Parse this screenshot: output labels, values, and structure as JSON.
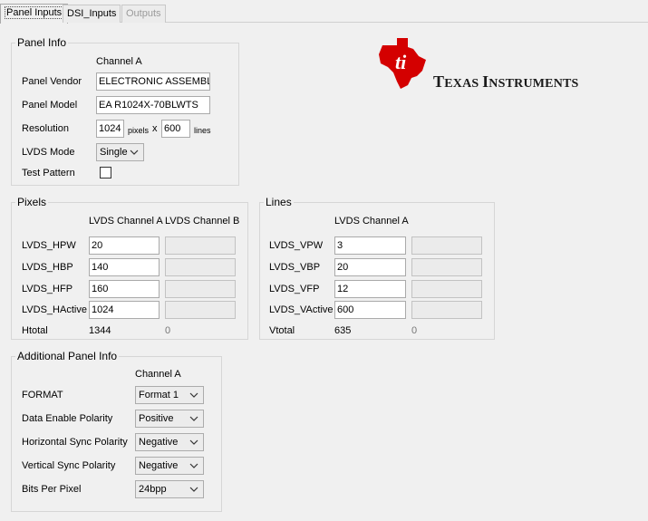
{
  "tabs": [
    {
      "label": "Panel Inputs"
    },
    {
      "label": "DSI_Inputs"
    },
    {
      "label": "Outputs"
    }
  ],
  "panel_info": {
    "title": "Panel Info",
    "channel_header": "Channel A",
    "vendor_label": "Panel Vendor",
    "vendor_value": "ELECTRONIC ASSEMBLY",
    "model_label": "Panel Model",
    "model_value": "EA R1024X-70BLWTS",
    "resolution_label": "Resolution",
    "res_width": "1024",
    "pixels_unit": "pixels",
    "x_sep": "x",
    "res_height": "600",
    "lines_unit": "lines",
    "lvds_mode_label": "LVDS Mode",
    "lvds_mode_value": "Single",
    "test_pattern_label": "Test Pattern",
    "test_pattern_checked": false
  },
  "logo": {
    "brand_big_1": "T",
    "brand_small_1": "EXAS ",
    "brand_big_2": "I",
    "brand_small_2": "NSTRUMENTS",
    "color": "#d40000"
  },
  "pixels": {
    "title": "Pixels",
    "col_a": "LVDS Channel A",
    "col_b": "LVDS Channel B",
    "rows": [
      {
        "label": "LVDS_HPW",
        "a": "20",
        "b": ""
      },
      {
        "label": "LVDS_HBP",
        "a": "140",
        "b": ""
      },
      {
        "label": "LVDS_HFP",
        "a": "160",
        "b": ""
      },
      {
        "label": "LVDS_HActive",
        "a": "1024",
        "b": ""
      }
    ],
    "total_label": "Htotal",
    "total_a": "1344",
    "total_b": "0"
  },
  "lines": {
    "title": "Lines",
    "col_a": "LVDS Channel A",
    "rows": [
      {
        "label": "LVDS_VPW",
        "a": "3",
        "b": ""
      },
      {
        "label": "LVDS_VBP",
        "a": "20",
        "b": ""
      },
      {
        "label": "LVDS_VFP",
        "a": "12",
        "b": ""
      },
      {
        "label": "LVDS_VActive",
        "a": "600",
        "b": ""
      }
    ],
    "total_label": "Vtotal",
    "total_a": "635",
    "total_b": "0"
  },
  "additional": {
    "title": "Additional Panel Info",
    "channel_header": "Channel A",
    "rows": [
      {
        "label": "FORMAT",
        "value": "Format 1"
      },
      {
        "label": "Data Enable Polarity",
        "value": "Positive"
      },
      {
        "label": "Horizontal Sync Polarity",
        "value": "Negative"
      },
      {
        "label": "Vertical Sync Polarity",
        "value": "Negative"
      },
      {
        "label": "Bits Per Pixel",
        "value": "24bpp"
      }
    ]
  }
}
